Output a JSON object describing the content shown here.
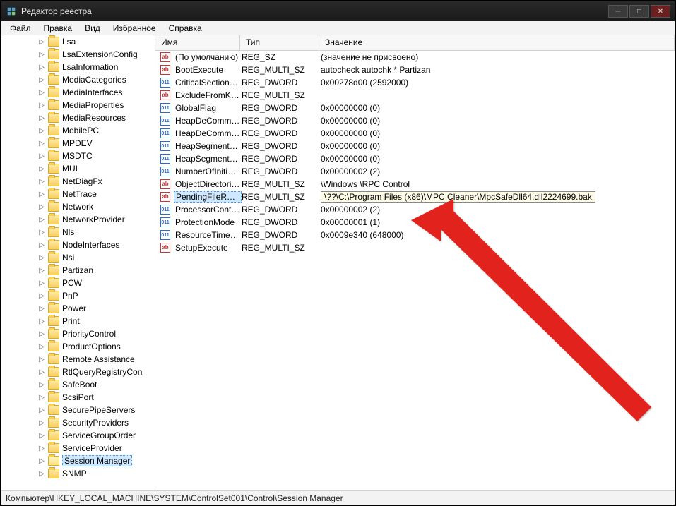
{
  "window": {
    "title": "Редактор реестра"
  },
  "menu": {
    "file": "Файл",
    "edit": "Правка",
    "view": "Вид",
    "favorites": "Избранное",
    "help": "Справка"
  },
  "columns": {
    "name": "Имя",
    "type": "Тип",
    "value": "Значение"
  },
  "tree": [
    {
      "label": "Lsa",
      "sel": false
    },
    {
      "label": "LsaExtensionConfig",
      "sel": false
    },
    {
      "label": "LsaInformation",
      "sel": false
    },
    {
      "label": "MediaCategories",
      "sel": false
    },
    {
      "label": "MediaInterfaces",
      "sel": false
    },
    {
      "label": "MediaProperties",
      "sel": false
    },
    {
      "label": "MediaResources",
      "sel": false
    },
    {
      "label": "MobilePC",
      "sel": false
    },
    {
      "label": "MPDEV",
      "sel": false
    },
    {
      "label": "MSDTC",
      "sel": false
    },
    {
      "label": "MUI",
      "sel": false
    },
    {
      "label": "NetDiagFx",
      "sel": false
    },
    {
      "label": "NetTrace",
      "sel": false
    },
    {
      "label": "Network",
      "sel": false
    },
    {
      "label": "NetworkProvider",
      "sel": false
    },
    {
      "label": "Nls",
      "sel": false
    },
    {
      "label": "NodeInterfaces",
      "sel": false
    },
    {
      "label": "Nsi",
      "sel": false
    },
    {
      "label": "Partizan",
      "sel": false
    },
    {
      "label": "PCW",
      "sel": false
    },
    {
      "label": "PnP",
      "sel": false
    },
    {
      "label": "Power",
      "sel": false
    },
    {
      "label": "Print",
      "sel": false
    },
    {
      "label": "PriorityControl",
      "sel": false
    },
    {
      "label": "ProductOptions",
      "sel": false
    },
    {
      "label": "Remote Assistance",
      "sel": false
    },
    {
      "label": "RtlQueryRegistryCon",
      "sel": false
    },
    {
      "label": "SafeBoot",
      "sel": false
    },
    {
      "label": "ScsiPort",
      "sel": false
    },
    {
      "label": "SecurePipeServers",
      "sel": false
    },
    {
      "label": "SecurityProviders",
      "sel": false
    },
    {
      "label": "ServiceGroupOrder",
      "sel": false
    },
    {
      "label": "ServiceProvider",
      "sel": false
    },
    {
      "label": "Session Manager",
      "sel": true
    },
    {
      "label": "SNMP",
      "sel": false
    }
  ],
  "values": [
    {
      "icon": "str",
      "name": "(По умолчанию)",
      "type": "REG_SZ",
      "value": "(значение не присвоено)",
      "sel": false
    },
    {
      "icon": "str",
      "name": "BootExecute",
      "type": "REG_MULTI_SZ",
      "value": "autocheck autochk * Partizan",
      "sel": false
    },
    {
      "icon": "bin",
      "name": "CriticalSectionTi...",
      "type": "REG_DWORD",
      "value": "0x00278d00 (2592000)",
      "sel": false
    },
    {
      "icon": "str",
      "name": "ExcludeFromKn...",
      "type": "REG_MULTI_SZ",
      "value": "",
      "sel": false
    },
    {
      "icon": "bin",
      "name": "GlobalFlag",
      "type": "REG_DWORD",
      "value": "0x00000000 (0)",
      "sel": false
    },
    {
      "icon": "bin",
      "name": "HeapDeCommit...",
      "type": "REG_DWORD",
      "value": "0x00000000 (0)",
      "sel": false
    },
    {
      "icon": "bin",
      "name": "HeapDeCommit...",
      "type": "REG_DWORD",
      "value": "0x00000000 (0)",
      "sel": false
    },
    {
      "icon": "bin",
      "name": "HeapSegmentC...",
      "type": "REG_DWORD",
      "value": "0x00000000 (0)",
      "sel": false
    },
    {
      "icon": "bin",
      "name": "HeapSegmentR...",
      "type": "REG_DWORD",
      "value": "0x00000000 (0)",
      "sel": false
    },
    {
      "icon": "bin",
      "name": "NumberOfInitial...",
      "type": "REG_DWORD",
      "value": "0x00000002 (2)",
      "sel": false
    },
    {
      "icon": "str",
      "name": "ObjectDirectories",
      "type": "REG_MULTI_SZ",
      "value": "\\Windows \\RPC Control",
      "sel": false
    },
    {
      "icon": "str",
      "name": "PendingFileRen...",
      "type": "REG_MULTI_SZ",
      "value": "\\??\\C:\\Program Files (x86)\\MPC Cleaner\\MpcSafeDll64.dll2224699.bak",
      "sel": true
    },
    {
      "icon": "bin",
      "name": "ProcessorControl",
      "type": "REG_DWORD",
      "value": "0x00000002 (2)",
      "sel": false
    },
    {
      "icon": "bin",
      "name": "ProtectionMode",
      "type": "REG_DWORD",
      "value": "0x00000001 (1)",
      "sel": false
    },
    {
      "icon": "bin",
      "name": "ResourceTimeo...",
      "type": "REG_DWORD",
      "value": "0x0009e340 (648000)",
      "sel": false
    },
    {
      "icon": "str",
      "name": "SetupExecute",
      "type": "REG_MULTI_SZ",
      "value": "",
      "sel": false
    }
  ],
  "status": "Компьютер\\HKEY_LOCAL_MACHINE\\SYSTEM\\ControlSet001\\Control\\Session Manager",
  "icons": {
    "ab": "ab",
    "bin": "011"
  }
}
